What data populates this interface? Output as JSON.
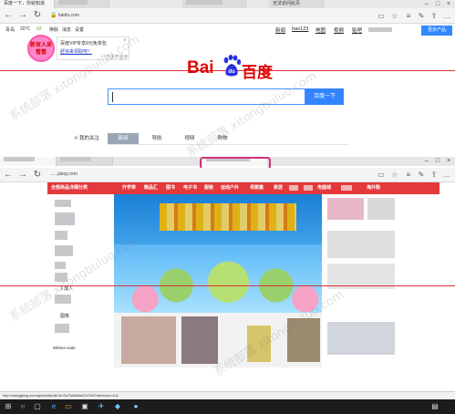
{
  "top_window": {
    "tabs": [
      {
        "title": "百度一下，你就知道"
      },
      {
        "title": ""
      },
      {
        "title": ""
      },
      {
        "title": "无法访问此页"
      }
    ],
    "url": "baidu.com",
    "weather": {
      "city": "青岛",
      "temp": "20°C",
      "aqi": "93",
      "links": [
        "换肤",
        "消息",
        "设置"
      ]
    },
    "top_nav": [
      "新闻",
      "hao123",
      "地图",
      "视频",
      "贴吧"
    ],
    "more_button": "更多产品",
    "promo": {
      "badge": "新官人来看看",
      "line1": "百度VIP专享9元免单包",
      "line2": "赶快来领取吧！",
      "checkbox": "下次不显示"
    },
    "logo": {
      "bai": "Bai",
      "du_char": "du",
      "chinese": "百度"
    },
    "search": {
      "value": "",
      "button": "百度一下"
    },
    "home_tabs": [
      {
        "label": "我的关注"
      },
      {
        "label": "新闻"
      },
      {
        "label": "导航"
      },
      {
        "label": "视频"
      },
      {
        "label": "购物"
      }
    ]
  },
  "bottom_window": {
    "url": "......jiang.com",
    "nav_left": "全部商品详细分类",
    "nav_items": [
      "开学季",
      "精品汇",
      "图书",
      "电子书",
      "服装",
      "运动户外",
      "母婴童",
      "家居",
      "",
      "电器城",
      "",
      "海外购"
    ],
    "sidebar_items": [
      "",
      "",
      "",
      "",
      "",
      "",
      "",
      "",
      "1 成人",
      "",
      "",
      "图像",
      "",
      "Wifeen-wide"
    ],
    "status_url": "http://xiangjiang.com/api/statis/clk?d=2a73a6d3dd7c7/&Preference=0-8"
  },
  "watermark_text": "系统部落 xitongbuluo.com",
  "colors": {
    "baidu_red": "#e10602",
    "baidu_blue": "#3385ff",
    "mall_red": "#e4393c",
    "highlight": "#d3307a"
  }
}
